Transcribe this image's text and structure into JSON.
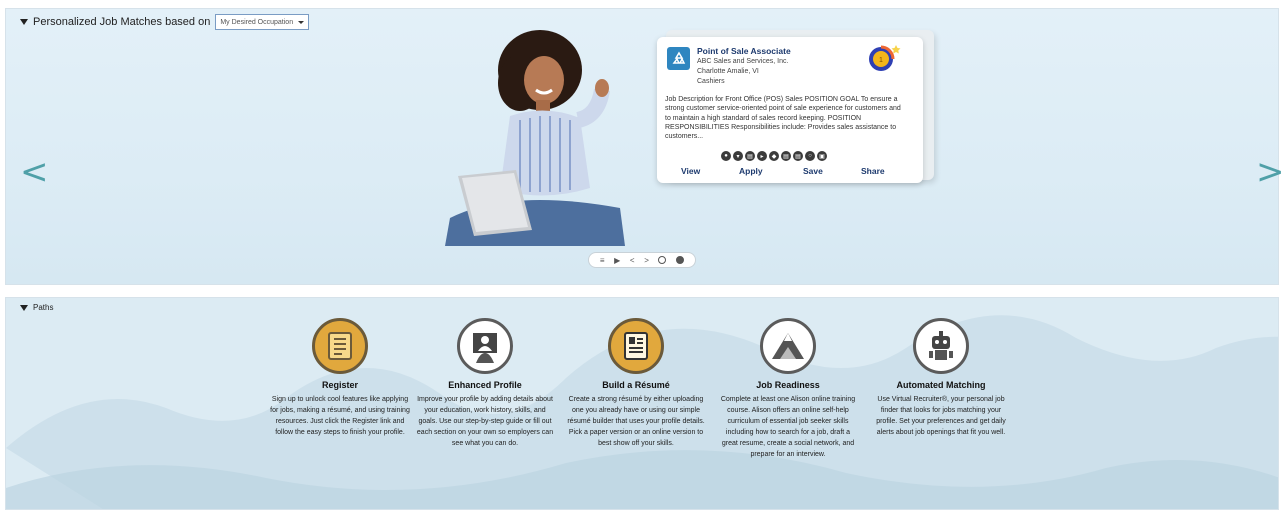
{
  "matches": {
    "header": "Personalized Job Matches based on",
    "occupation_select": "My Desired Occupation",
    "prev_arrow": "<",
    "next_arrow": ">",
    "job": {
      "title": "Point of Sale Associate",
      "company": "ABC Sales and Services, Inc.",
      "location": "Charlotte Amalie, VI",
      "category": "Cashiers",
      "description": "Job Description for Front Office (POS) Sales POSITION GOAL To ensure a strong customer service-oriented point of sale experience for customers and to maintain a high standard of sales record keeping. POSITION RESPONSIBILITIES Responsibilities include: Provides sales assistance to customers...",
      "actions": {
        "view": "View",
        "apply": "Apply",
        "save": "Save",
        "share": "Share"
      }
    },
    "carousel": {
      "list": "≡",
      "play": "▶",
      "prev": "<",
      "next": ">"
    }
  },
  "paths": {
    "header": "Paths",
    "items": [
      {
        "title": "Register",
        "icon": "document-icon",
        "color": "#e1a83d",
        "desc": "Sign up to unlock cool features like applying for jobs, making a résumé, and using training resources. Just click the Register link and follow the easy steps to finish your profile."
      },
      {
        "title": "Enhanced Profile",
        "icon": "person-icon",
        "color": "#ffffff",
        "desc": "Improve your profile by adding details about your education, work history, skills, and goals. Use our step-by-step guide or fill out each section on your own so employers can see what you can do."
      },
      {
        "title": "Build a Résumé",
        "icon": "resume-icon",
        "color": "#e1a83d",
        "desc": "Create a strong résumé by either uploading one you already have or using our simple résumé builder that uses your profile details. Pick a paper version or an online version to best show off your skills."
      },
      {
        "title": "Job Readiness",
        "icon": "mountain-icon",
        "color": "#ffffff",
        "desc": "Complete at least one Alison online training course. Alison offers an online self-help curriculum of essential job seeker skills including how to search for a job, draft a great resume, create a social network, and prepare for an interview."
      },
      {
        "title": "Automated Matching",
        "icon": "robot-icon",
        "color": "#ffffff",
        "desc": "Use Virtual Recruiter®, your personal job finder that looks for jobs matching your profile. Set your preferences and get daily alerts about job openings that fit you well."
      }
    ]
  }
}
